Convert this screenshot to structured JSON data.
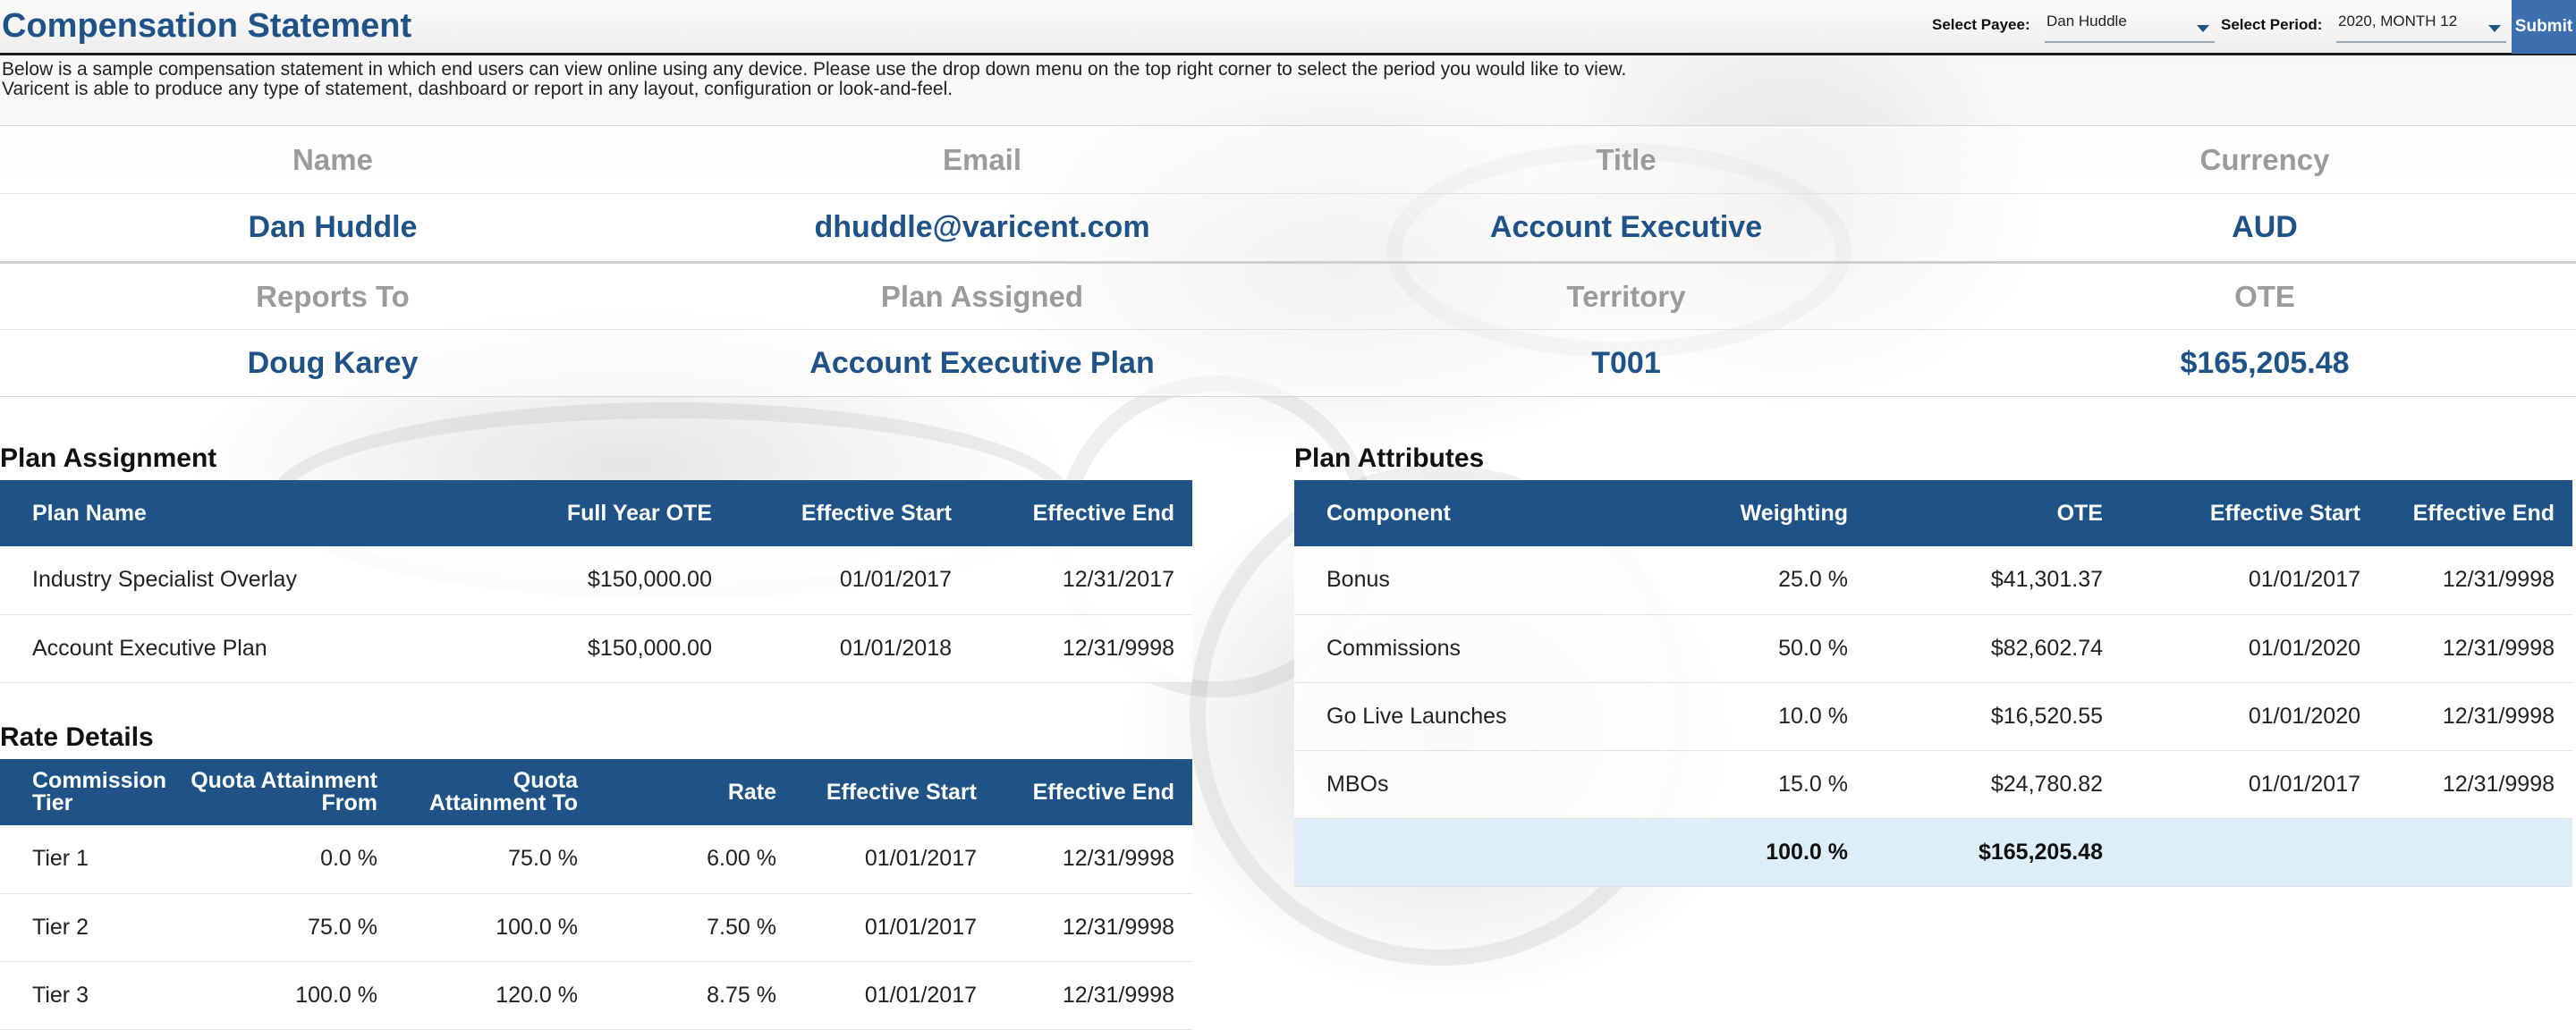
{
  "header": {
    "title": "Compensation Statement",
    "payee_label": "Select Payee:",
    "payee_value": "Dan Huddle",
    "period_label": "Select Period:",
    "period_value": "2020, MONTH 12",
    "submit_label": "Submit"
  },
  "intro": {
    "line1": "Below is a sample compensation statement in which end users can view online using any device.  Please use the drop down menu on the top right corner to select the period you would like to view.",
    "line2": "Varicent is able to produce any type of statement, dashboard or report in any layout, configuration or look-and-feel."
  },
  "summary": {
    "labels1": [
      "Name",
      "Email",
      "Title",
      "Currency"
    ],
    "values1": [
      "Dan Huddle",
      "dhuddle@varicent.com",
      "Account Executive",
      "AUD"
    ],
    "labels2": [
      "Reports To",
      "Plan Assigned",
      "Territory",
      "OTE"
    ],
    "values2": [
      "Doug Karey",
      "Account Executive Plan",
      "T001",
      "$165,205.48"
    ]
  },
  "plan_assignment": {
    "title": "Plan Assignment",
    "headers": [
      "Plan Name",
      "Full Year OTE",
      "Effective Start",
      "Effective End"
    ],
    "rows": [
      [
        "Industry Specialist Overlay",
        "$150,000.00",
        "01/01/2017",
        "12/31/2017"
      ],
      [
        "Account Executive Plan",
        "$150,000.00",
        "01/01/2018",
        "12/31/9998"
      ]
    ]
  },
  "rate_details": {
    "title": "Rate Details",
    "headers": [
      "Commission Tier",
      "Quota Attainment From",
      "Quota Attainment To",
      "Rate",
      "Effective Start",
      "Effective End"
    ],
    "rows": [
      [
        "Tier 1",
        "0.0 %",
        "75.0 %",
        "6.00 %",
        "01/01/2017",
        "12/31/9998"
      ],
      [
        "Tier 2",
        "75.0 %",
        "100.0 %",
        "7.50 %",
        "01/01/2017",
        "12/31/9998"
      ],
      [
        "Tier 3",
        "100.0 %",
        "120.0 %",
        "8.75 %",
        "01/01/2017",
        "12/31/9998"
      ]
    ]
  },
  "plan_attributes": {
    "title": "Plan Attributes",
    "headers": [
      "Component",
      "Weighting",
      "OTE",
      "Effective Start",
      "Effective End"
    ],
    "rows": [
      [
        "Bonus",
        "25.0 %",
        "$41,301.37",
        "01/01/2017",
        "12/31/9998"
      ],
      [
        "Commissions",
        "50.0 %",
        "$82,602.74",
        "01/01/2020",
        "12/31/9998"
      ],
      [
        "Go Live Launches",
        "10.0 %",
        "$16,520.55",
        "01/01/2020",
        "12/31/9998"
      ],
      [
        "MBOs",
        "15.0 %",
        "$24,780.82",
        "01/01/2017",
        "12/31/9998"
      ]
    ],
    "total": [
      "",
      "100.0 %",
      "$165,205.48",
      "",
      ""
    ]
  },
  "colors": {
    "brand_blue": "#1f5387",
    "header_label_grey": "#9b9b9b",
    "total_row_bg": "#ddeef8",
    "submit_bg": "#3b6fb0"
  }
}
